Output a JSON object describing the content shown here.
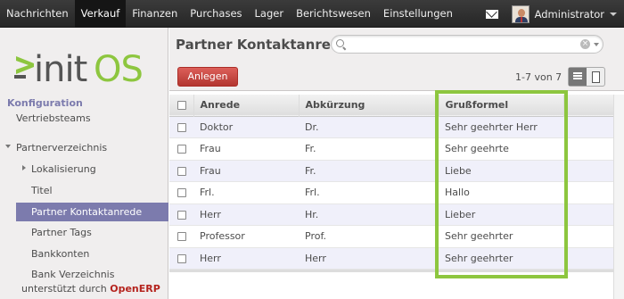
{
  "topbar": {
    "menu": [
      "Nachrichten",
      "Verkauf",
      "Finanzen",
      "Purchases",
      "Lager",
      "Berichtswesen",
      "Einstellungen"
    ],
    "active_index": 1,
    "user_name": "Administrator",
    "mail_icon": "envelope-icon"
  },
  "sidebar": {
    "logo_text": "initOS",
    "section": "Konfiguration",
    "items": [
      {
        "label": "Vertriebsteams"
      },
      {
        "label": "Partnerverzeichnis"
      },
      {
        "label": "Lokalisierung"
      },
      {
        "label": "Titel"
      },
      {
        "label": "Partner Kontaktanrede"
      },
      {
        "label": "Partner Tags"
      },
      {
        "label": "Bankkonten"
      },
      {
        "label": "Bank Verzeichnis"
      }
    ],
    "powered_by": "unterstützt durch",
    "powered_brand": "OpenERP"
  },
  "main": {
    "title": "Partner Kontaktanrede",
    "search_placeholder": "",
    "create_label": "Anlegen",
    "pager": "1-7 von 7",
    "columns": [
      "Anrede",
      "Abkürzung",
      "Grußformel"
    ],
    "rows": [
      [
        "Doktor",
        "Dr.",
        "Sehr geehrter Herr"
      ],
      [
        "Frau",
        "Fr.",
        "Sehr geehrte"
      ],
      [
        "Frau",
        "Fr.",
        "Liebe"
      ],
      [
        "Frl.",
        "Frl.",
        "Hallo"
      ],
      [
        "Herr",
        "Hr.",
        "Lieber"
      ],
      [
        "Professor",
        "Prof.",
        "Sehr geehrter"
      ],
      [
        "Herr",
        "Herr",
        "Sehr geehrter"
      ]
    ]
  },
  "colors": {
    "accent": "#7c7bad",
    "create_button": "#c4413b",
    "highlight": "#8dc63f",
    "brand": "#b5241e"
  }
}
